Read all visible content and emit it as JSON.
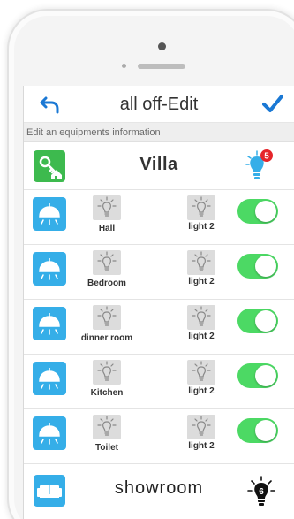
{
  "nav": {
    "title": "all off-Edit"
  },
  "subheader": {
    "text": "Edit an equipments information"
  },
  "group": {
    "name": "Villa",
    "badge": "5"
  },
  "rows": [
    {
      "name": "Hall",
      "light_label": "light 2",
      "on": true
    },
    {
      "name": "Bedroom",
      "light_label": "light 2",
      "on": true
    },
    {
      "name": "dinner room",
      "light_label": "light 2",
      "on": true
    },
    {
      "name": "Kitchen",
      "light_label": "light 2",
      "on": true
    },
    {
      "name": "Toilet",
      "light_label": "light 2",
      "on": true
    }
  ],
  "group2": {
    "name": "showroom",
    "badge": "6"
  },
  "colors": {
    "accent": "#1a78d4",
    "green": "#4cd964",
    "blue_icon": "#35aee8",
    "green_icon": "#3dba4e",
    "badge": "#e5252a"
  }
}
